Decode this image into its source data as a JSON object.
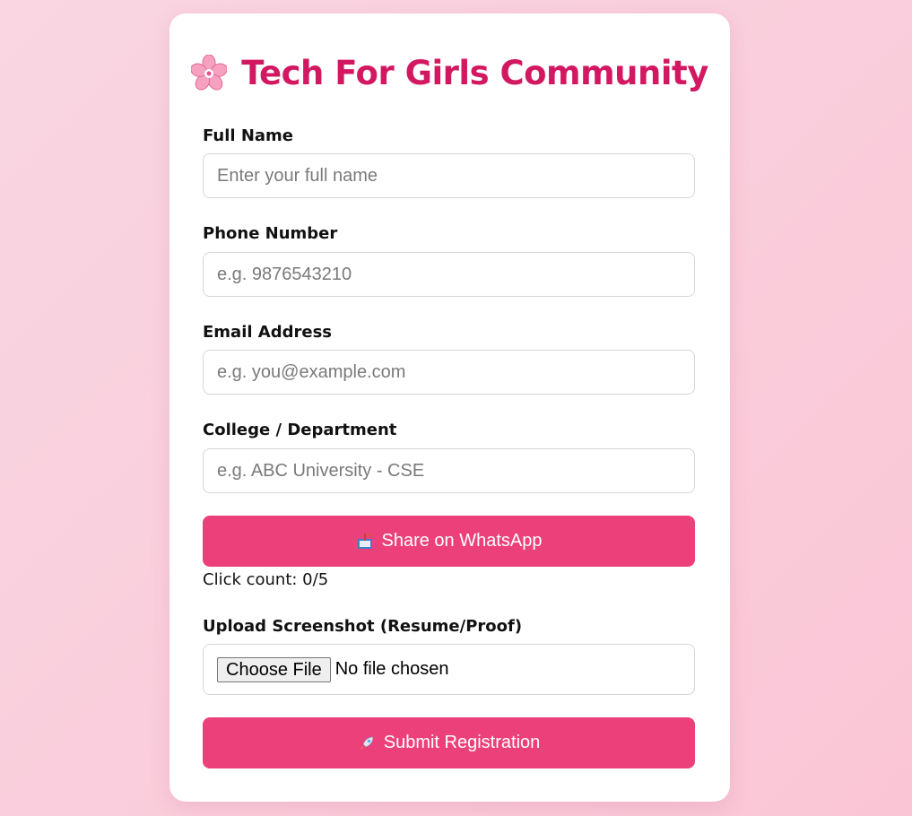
{
  "header": {
    "title": "Tech For Girls Community",
    "title_icon": "cherry-blossom-icon",
    "title_color": "#d31862"
  },
  "form": {
    "full_name": {
      "label": "Full Name",
      "placeholder": "Enter your full name",
      "value": ""
    },
    "phone": {
      "label": "Phone Number",
      "placeholder": "e.g. 9876543210",
      "value": ""
    },
    "email": {
      "label": "Email Address",
      "placeholder": "e.g. you@example.com",
      "value": ""
    },
    "college": {
      "label": "College / Department",
      "placeholder": "e.g. ABC University - CSE",
      "value": ""
    },
    "share_button": {
      "label": "Share on WhatsApp",
      "icon": "mailbox-icon"
    },
    "click_count": "Click count: 0/5",
    "upload": {
      "label": "Upload Screenshot (Resume/Proof)",
      "choose_label": "Choose File",
      "status": "No file chosen"
    },
    "submit_button": {
      "label": "Submit Registration",
      "icon": "rocket-icon"
    }
  },
  "colors": {
    "accent": "#ec407a",
    "background": "#f9d6e2",
    "card": "#ffffff"
  }
}
